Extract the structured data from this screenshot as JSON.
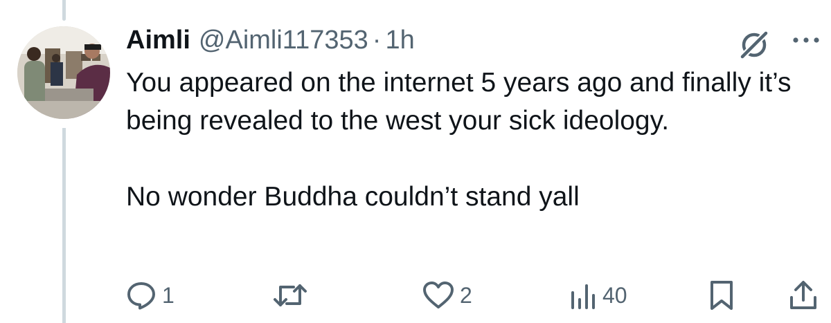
{
  "tweet": {
    "author_name": "Aimli",
    "author_handle": "@Aimli117353",
    "separator": "·",
    "time": "1h",
    "text_lines": [
      "You appeared on the internet 5 years ago and finally it’s being revealed to the west your sick ideology.",
      "No wonder Buddha couldn’t stand yall"
    ]
  },
  "actions": {
    "reply_count": "1",
    "retweet_count": "",
    "like_count": "2",
    "views_count": "40"
  },
  "icons": {
    "header": [
      "grok-icon",
      "more-icon"
    ],
    "actions": [
      "reply-icon",
      "retweet-icon",
      "like-icon",
      "views-icon",
      "bookmark-icon",
      "share-icon"
    ]
  },
  "colors": {
    "text": "#0f1419",
    "secondary": "#536471",
    "thread_line": "#cfd9de"
  }
}
